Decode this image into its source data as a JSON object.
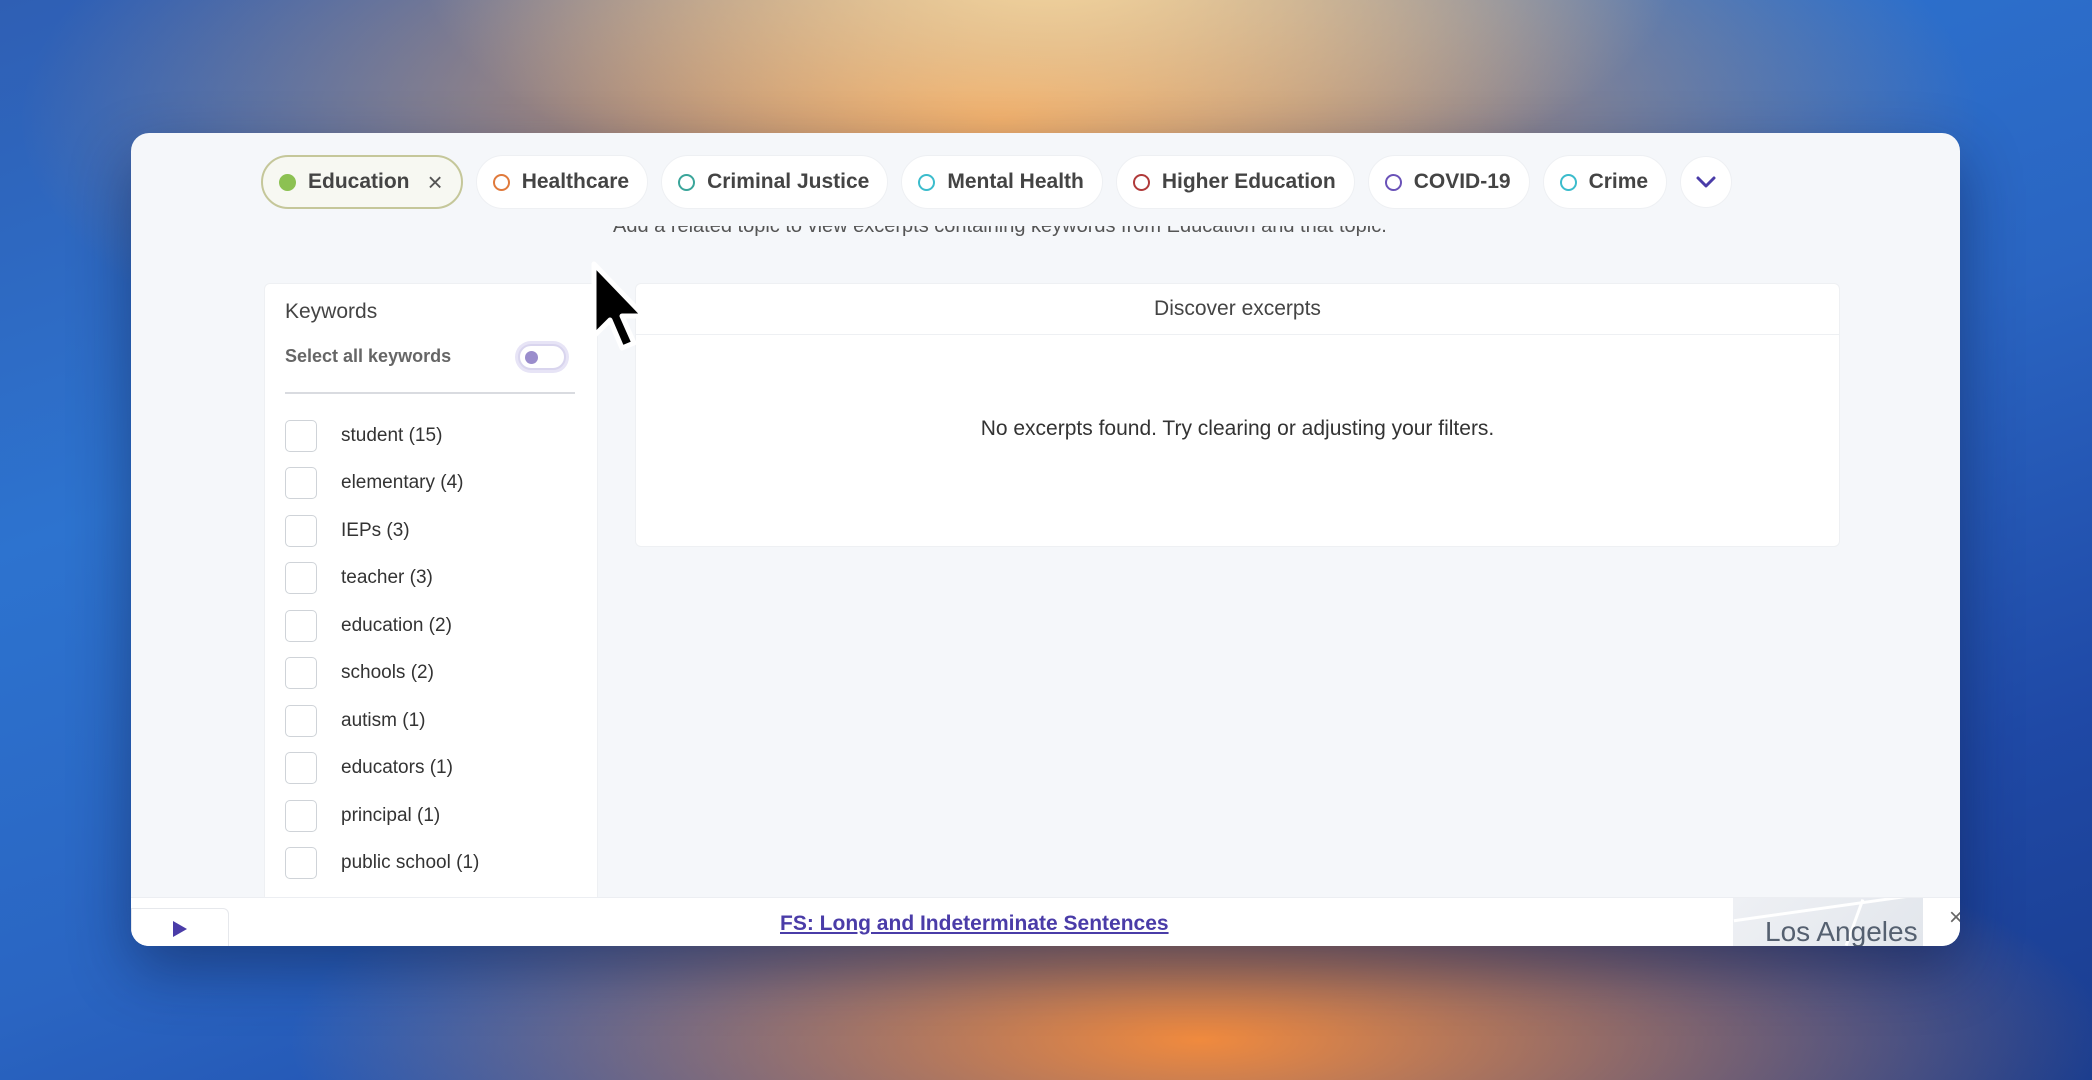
{
  "topics": [
    {
      "label": "Education",
      "active": true,
      "color": "#8cc152"
    },
    {
      "label": "Healthcare",
      "active": false,
      "color": "#e07a3c"
    },
    {
      "label": "Criminal Justice",
      "active": false,
      "color": "#3aa59a"
    },
    {
      "label": "Mental Health",
      "active": false,
      "color": "#3bbccc"
    },
    {
      "label": "Higher Education",
      "active": false,
      "color": "#b03a3a"
    },
    {
      "label": "COVID-19",
      "active": false,
      "color": "#6a52b8"
    },
    {
      "label": "Crime",
      "active": false,
      "color": "#3bbccc"
    }
  ],
  "topics_more_icon": "chevron-down-icon",
  "hint_text": "Add a related topic to view excerpts containing keywords from Education and that topic.",
  "keywords": {
    "title": "Keywords",
    "select_all_label": "Select all keywords",
    "select_all_on": false,
    "items": [
      {
        "label": "student (15)"
      },
      {
        "label": "elementary (4)"
      },
      {
        "label": "IEPs (3)"
      },
      {
        "label": "teacher (3)"
      },
      {
        "label": "education (2)"
      },
      {
        "label": "schools (2)"
      },
      {
        "label": "autism (1)"
      },
      {
        "label": "educators (1)"
      },
      {
        "label": "principal (1)"
      },
      {
        "label": "public school (1)"
      }
    ]
  },
  "discover": {
    "title": "Discover excerpts",
    "empty_message": "No excerpts found. Try clearing or adjusting your filters."
  },
  "bottom_bar": {
    "link_text": "FS: Long and Indeterminate Sentences",
    "map_label": "Los Angeles",
    "close_icon": "close-icon",
    "play_icon": "play-icon"
  },
  "colors": {
    "accent": "#4a3ca8",
    "active_chip_border": "#c5c79a"
  }
}
